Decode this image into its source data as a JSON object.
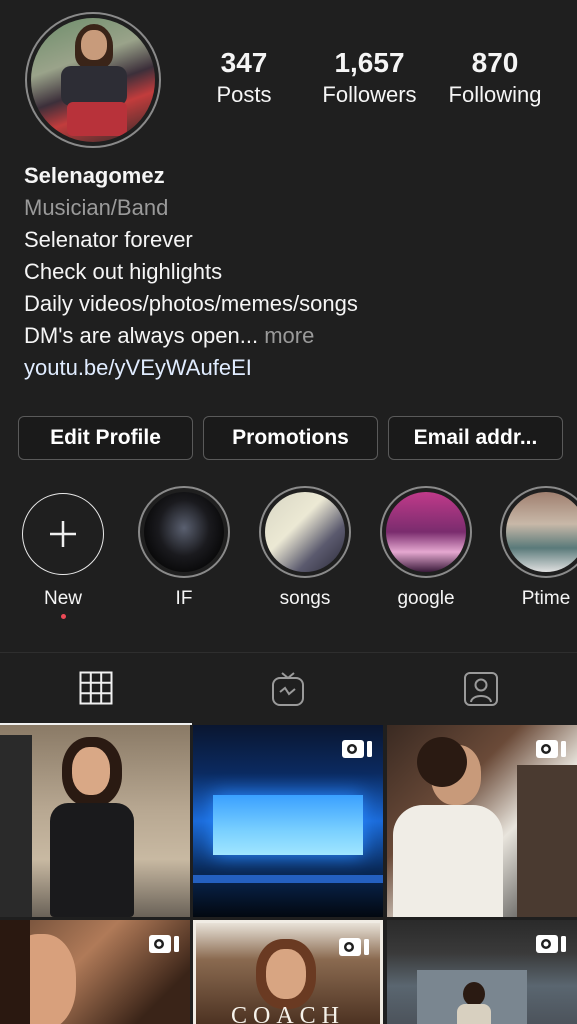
{
  "profile": {
    "avatar_icon": "profile-photo",
    "stats": {
      "posts_count": "347",
      "posts_label": "Posts",
      "followers_count": "1,657",
      "followers_label": "Followers",
      "following_count": "870",
      "following_label": "Following"
    },
    "bio": {
      "username": "Selenagomez",
      "category": "Musician/Band",
      "line1": "Selenator forever",
      "line2": "Check out highlights",
      "line3": "Daily videos/photos/memes/songs",
      "line4": "DM's are always open...",
      "more_label": " more",
      "link": "youtu.be/yVEyWAufeEI"
    }
  },
  "buttons": {
    "edit_profile": "Edit Profile",
    "promotions": "Promotions",
    "email": "Email addr..."
  },
  "highlights": [
    {
      "label": "New",
      "icon": "plus-icon"
    },
    {
      "label": "IF"
    },
    {
      "label": "songs"
    },
    {
      "label": "google"
    },
    {
      "label": "Ptime"
    }
  ],
  "tabs": [
    {
      "icon": "grid-icon",
      "active": true
    },
    {
      "icon": "igtv-icon",
      "active": false
    },
    {
      "icon": "tagged-icon",
      "active": false
    }
  ],
  "grid_video_icon": "video-camera-icon",
  "posts": [
    {
      "overlay_text": ""
    },
    {
      "overlay_text": ""
    },
    {
      "overlay_text": ""
    },
    {
      "overlay_text": ""
    },
    {
      "overlay_text": "COACH"
    },
    {
      "overlay_text": ""
    }
  ],
  "colors": {
    "background": "#1f1f1f",
    "text": "#f5f5f5",
    "secondary_text": "#9a9a9a",
    "notification_dot": "#ed4956"
  }
}
